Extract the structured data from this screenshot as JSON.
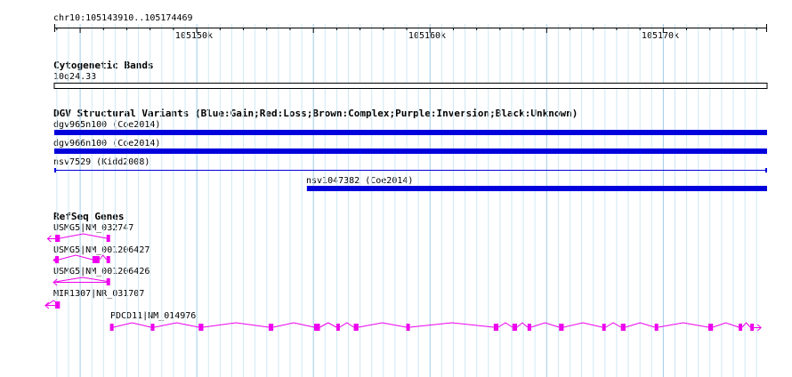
{
  "ruler": {
    "region": "chr10:105143910..105174469",
    "start": 105143910,
    "end": 105174469,
    "ticks": [
      {
        "pos": 105150000,
        "label": "105150k"
      },
      {
        "pos": 105160000,
        "label": "105160k"
      },
      {
        "pos": 105170000,
        "label": "105170k"
      }
    ]
  },
  "tracks": {
    "cyto": {
      "title": "Cytogenetic Bands",
      "band": "10q24.33"
    },
    "dgv": {
      "title": "DGV Structural Variants (Blue:Gain;Red:Loss;Brown:Complex;Purple:Inversion;Black:Unknown)",
      "color": "#0000dd",
      "features": [
        {
          "label": "dgv965n100 (Coe2014)",
          "start": 105143910,
          "end": 105174469,
          "style": "thick"
        },
        {
          "label": "dgv966n100 (Coe2014)",
          "start": 105143910,
          "end": 105174469,
          "style": "thick"
        },
        {
          "label": "nsv7529 (Kidd2008)",
          "start": 105143910,
          "end": 105174469,
          "style": "thin"
        },
        {
          "label": "nsv1047382 (Coe2014)",
          "start": 105154740,
          "end": 105174469,
          "style": "thick"
        }
      ]
    },
    "refseq": {
      "title": "RefSeq Genes",
      "color": "#ee00ee",
      "genes": [
        {
          "label": "USMG5|NM_032747",
          "strand": "-",
          "start": 105143700,
          "end": 105146300,
          "exons": [
            [
              105143950,
              105144150
            ],
            [
              105146150,
              105146300
            ]
          ]
        },
        {
          "label": "USMG5|NM_001206427",
          "strand": "-",
          "start": 105143950,
          "end": 105146300,
          "exons": [
            [
              105143950,
              105144050
            ],
            [
              105145550,
              105145850
            ],
            [
              105146150,
              105146300
            ]
          ]
        },
        {
          "label": "USMG5|NM_001206426",
          "strand": "-",
          "start": 105143950,
          "end": 105146300,
          "exons": [
            [
              105146150,
              105146300
            ]
          ]
        },
        {
          "label": "MIR1307|NR_031707",
          "strand": "-",
          "start": 105143600,
          "end": 105144150,
          "exons": [
            [
              105143950,
              105144150
            ]
          ]
        },
        {
          "label": "PDCD11|NM_014976",
          "strand": "+",
          "start": 105146300,
          "end": 105174100,
          "exons": [
            [
              105146300,
              105146450
            ],
            [
              105148050,
              105148200
            ],
            [
              105150100,
              105150300
            ],
            [
              105153100,
              105153300
            ],
            [
              105155050,
              105155300
            ],
            [
              105156000,
              105156150
            ],
            [
              105156750,
              105156950
            ],
            [
              105159000,
              105159150
            ],
            [
              105162750,
              105162950
            ],
            [
              105163550,
              105163750
            ],
            [
              105164200,
              105164350
            ],
            [
              105165550,
              105165750
            ],
            [
              105167400,
              105167550
            ],
            [
              105168200,
              105168400
            ],
            [
              105169650,
              105169800
            ],
            [
              105171950,
              105172150
            ],
            [
              105173250,
              105173400
            ],
            [
              105173750,
              105173850
            ]
          ]
        }
      ]
    }
  }
}
